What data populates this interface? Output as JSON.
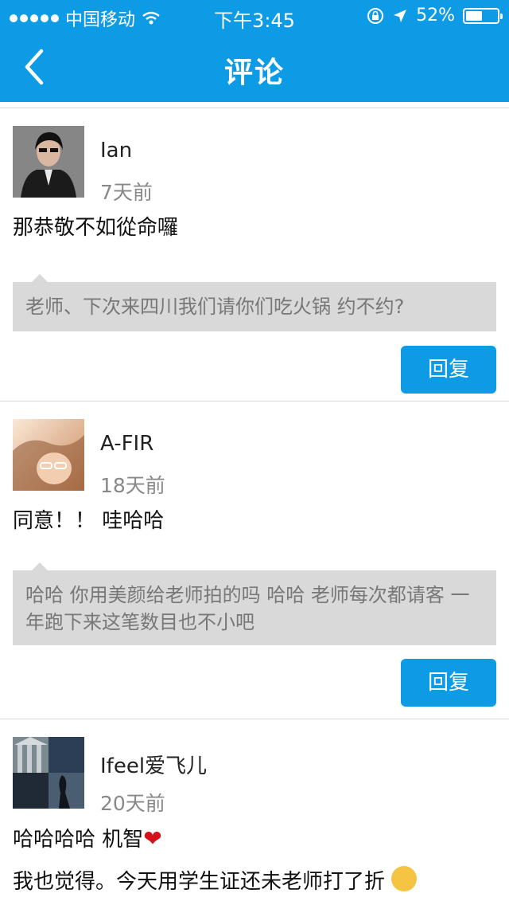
{
  "status_bar": {
    "carrier": "中国移动",
    "time": "下午3:45",
    "battery": "52%",
    "battery_level": 0.52
  },
  "nav": {
    "title": "评论",
    "back_icon": "chevron-left-icon"
  },
  "colors": {
    "primary": "#0d9be6",
    "reply_bg": "#d9d9d9"
  },
  "comments": [
    {
      "user": "Ian",
      "time": "7天前",
      "text": "那恭敬不如從命囉",
      "reply": "老师、下次来四川我们请你们吃火锅 约不约?",
      "reply_button": "回复"
    },
    {
      "user": "A-FIR",
      "time": "18天前",
      "text": "同意！！ 哇哈哈",
      "reply": "哈哈 你用美颜给老师拍的吗 哈哈 老师每次都请客 一年跑下来这笔数目也不小吧",
      "reply_button": "回复"
    },
    {
      "user": "Ifeel爱飞儿",
      "time": "20天前",
      "text_line1": "哈哈哈哈 机智",
      "text_line2": "我也觉得。今天用学生证还未老师打了折"
    }
  ]
}
